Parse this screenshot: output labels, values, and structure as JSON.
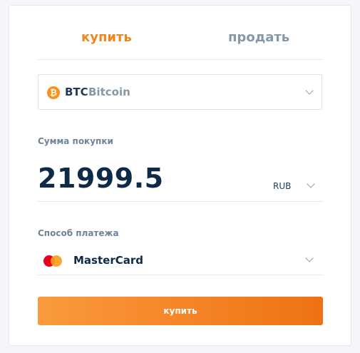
{
  "tabs": {
    "buy_label": "купить",
    "sell_label": "продать"
  },
  "coin": {
    "icon": "bitcoin-icon",
    "icon_glyph": "₿",
    "ticker": "BTC",
    "name": "Bitcoin"
  },
  "amount": {
    "label": "Сумма покупки",
    "value": "21999.5",
    "currency": "RUB"
  },
  "payment": {
    "label": "Способ платежа",
    "method": "MasterCard",
    "icon": "mastercard-icon"
  },
  "action": {
    "submit_label": "купить"
  },
  "colors": {
    "accent": "#f0861f",
    "inactive_tab": "#8597ab",
    "text_dark": "#0f2a47"
  }
}
